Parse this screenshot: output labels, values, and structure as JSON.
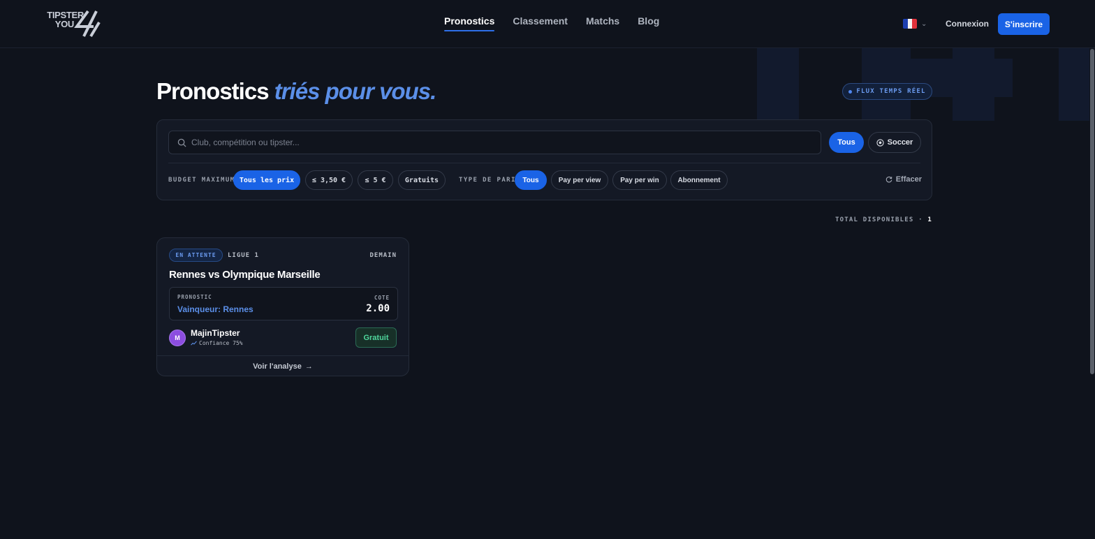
{
  "header": {
    "logo": {
      "line1": "TIPSTER",
      "line2": "YOU"
    },
    "nav": [
      {
        "label": "Pronostics",
        "active": true
      },
      {
        "label": "Classement",
        "active": false
      },
      {
        "label": "Matchs",
        "active": false
      },
      {
        "label": "Blog",
        "active": false
      }
    ],
    "language": "fr",
    "login_label": "Connexion",
    "signup_label": "S'inscrire"
  },
  "hero": {
    "title_plain": "Pronostics",
    "title_accent": "triés pour vous.",
    "live_badge": "FLUX TEMPS RÉEL"
  },
  "filters": {
    "search_placeholder": "Club, compétition ou tipster...",
    "sport_all_label": "Tous",
    "sport_soccer_label": "Soccer",
    "budget_label": "BUDGET MAXIMUM",
    "budget_options": [
      "Tous les prix",
      "≤ 3,50 €",
      "≤ 5 €",
      "Gratuits"
    ],
    "budget_selected": "Tous les prix",
    "bet_type_label": "TYPE DE PARI",
    "bet_type_options": [
      "Tous",
      "Pay per view",
      "Pay per win",
      "Abonnement"
    ],
    "bet_type_selected": "Tous",
    "clear_label": "Effacer"
  },
  "results": {
    "total_label": "TOTAL DISPONIBLES ·",
    "total_count": "1"
  },
  "card": {
    "status": "EN ATTENTE",
    "league": "LIGUE 1",
    "when": "DEMAIN",
    "match": "Rennes vs Olympique Marseille",
    "pick_label": "PRONOSTIC",
    "pick_value": "Vainqueur: Rennes",
    "odds_label": "COTE",
    "odds_value": "2.00",
    "tipster_initial": "M",
    "tipster_name": "MajinTipster",
    "confidence": "Confiance 75%",
    "price_label": "Gratuit",
    "cta_label": "Voir l'analyse"
  },
  "colors": {
    "accent": "#1a63e6",
    "accent_text": "#5b8fe8",
    "background": "#0f131c",
    "free_green": "#4fd69c",
    "avatar": "#8c4de0"
  }
}
